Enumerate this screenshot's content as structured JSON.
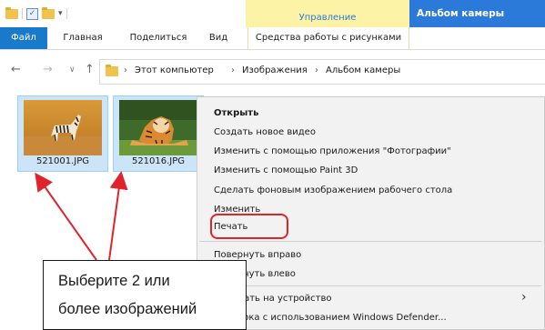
{
  "titlebar": {
    "context_tab": "Управление",
    "window_title": "Альбом камеры"
  },
  "ribbon": {
    "tabs": [
      "Файл",
      "Главная",
      "Поделиться",
      "Вид",
      "Средства работы с рисунками"
    ]
  },
  "address": {
    "crumbs": [
      "Этот компьютер",
      "Изображения",
      "Альбом камеры"
    ]
  },
  "files": [
    {
      "name": "521001.JPG"
    },
    {
      "name": "521016.JPG"
    }
  ],
  "context_menu": {
    "items": [
      "Открыть",
      "Создать новое видео",
      "Изменить с помощью приложения \"Фотографии\"",
      "Изменить с помощью Paint 3D",
      "Сделать фоновым изображением рабочего стола",
      "Изменить",
      "Печать",
      "Повернуть вправо",
      "Повернуть влево",
      "Передать на устройство",
      "Проверка с использованием Windows Defender..."
    ]
  },
  "callout": {
    "line1": "Выберите 2 или",
    "line2": "более изображений"
  },
  "colors": {
    "accent": "#1979ca",
    "title_bar": "#2b79d8",
    "context_tab": "#fcf3a7",
    "selection": "#cce4f7",
    "highlight": "#e0242b"
  }
}
